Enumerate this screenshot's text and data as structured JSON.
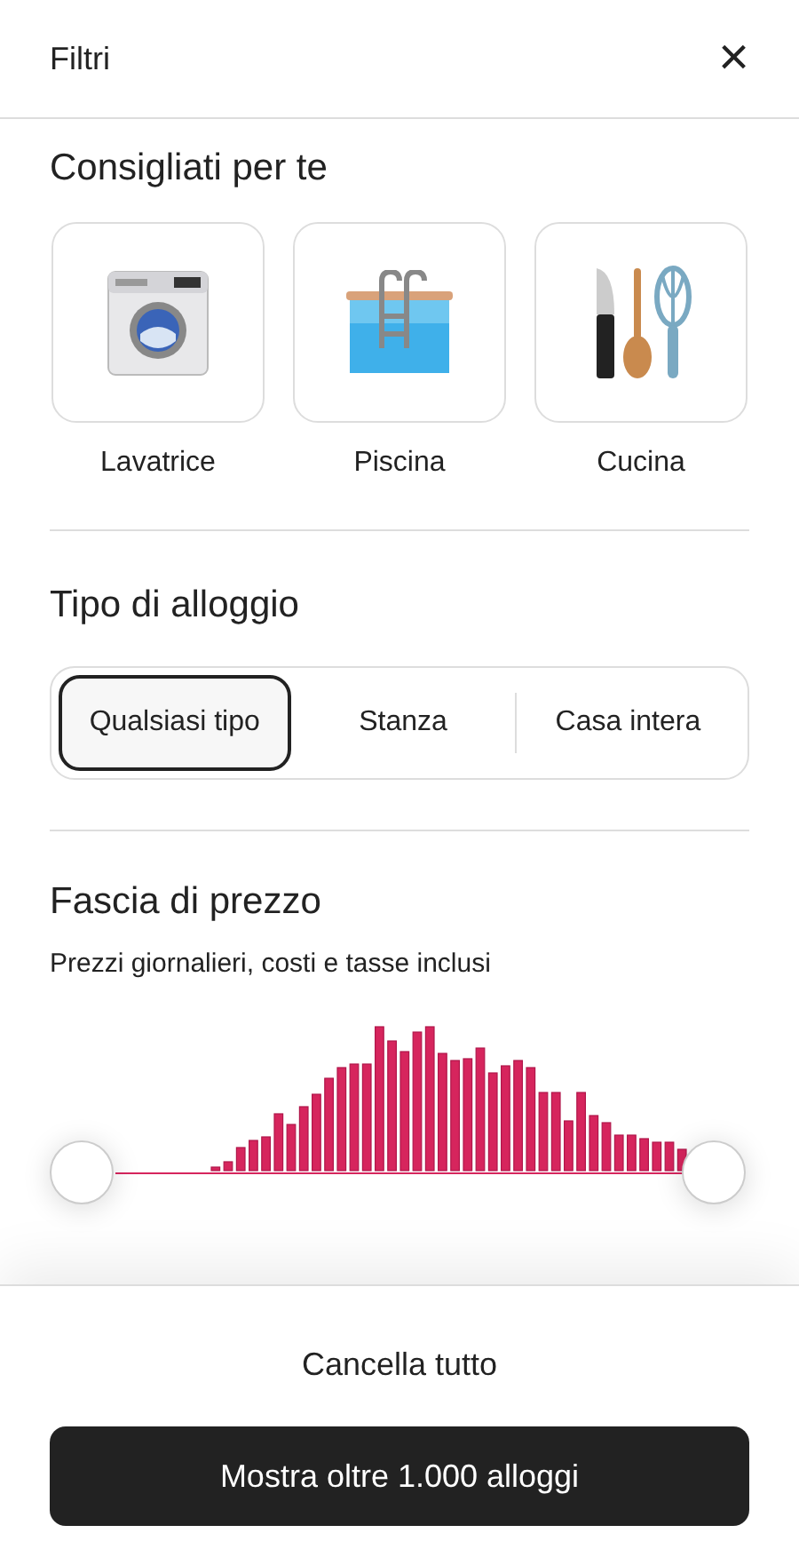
{
  "header": {
    "title": "Filtri",
    "close": "×"
  },
  "recommended": {
    "title": "Consigliati per te",
    "items": [
      {
        "kind": "washer",
        "label": "Lavatrice"
      },
      {
        "kind": "pool",
        "label": "Piscina"
      },
      {
        "kind": "kitchen",
        "label": "Cucina"
      }
    ]
  },
  "place_type": {
    "title": "Tipo di alloggio",
    "options": [
      {
        "label": "Qualsiasi tipo",
        "selected": true
      },
      {
        "label": "Stanza",
        "selected": false
      },
      {
        "label": "Casa intera",
        "selected": false
      }
    ]
  },
  "price": {
    "title": "Fascia di prezzo",
    "subtitle": "Prezzi giornalieri, costi e tasse inclusi"
  },
  "footer": {
    "clear": "Cancella tutto",
    "show": "Mostra oltre 1.000 alloggi"
  }
}
